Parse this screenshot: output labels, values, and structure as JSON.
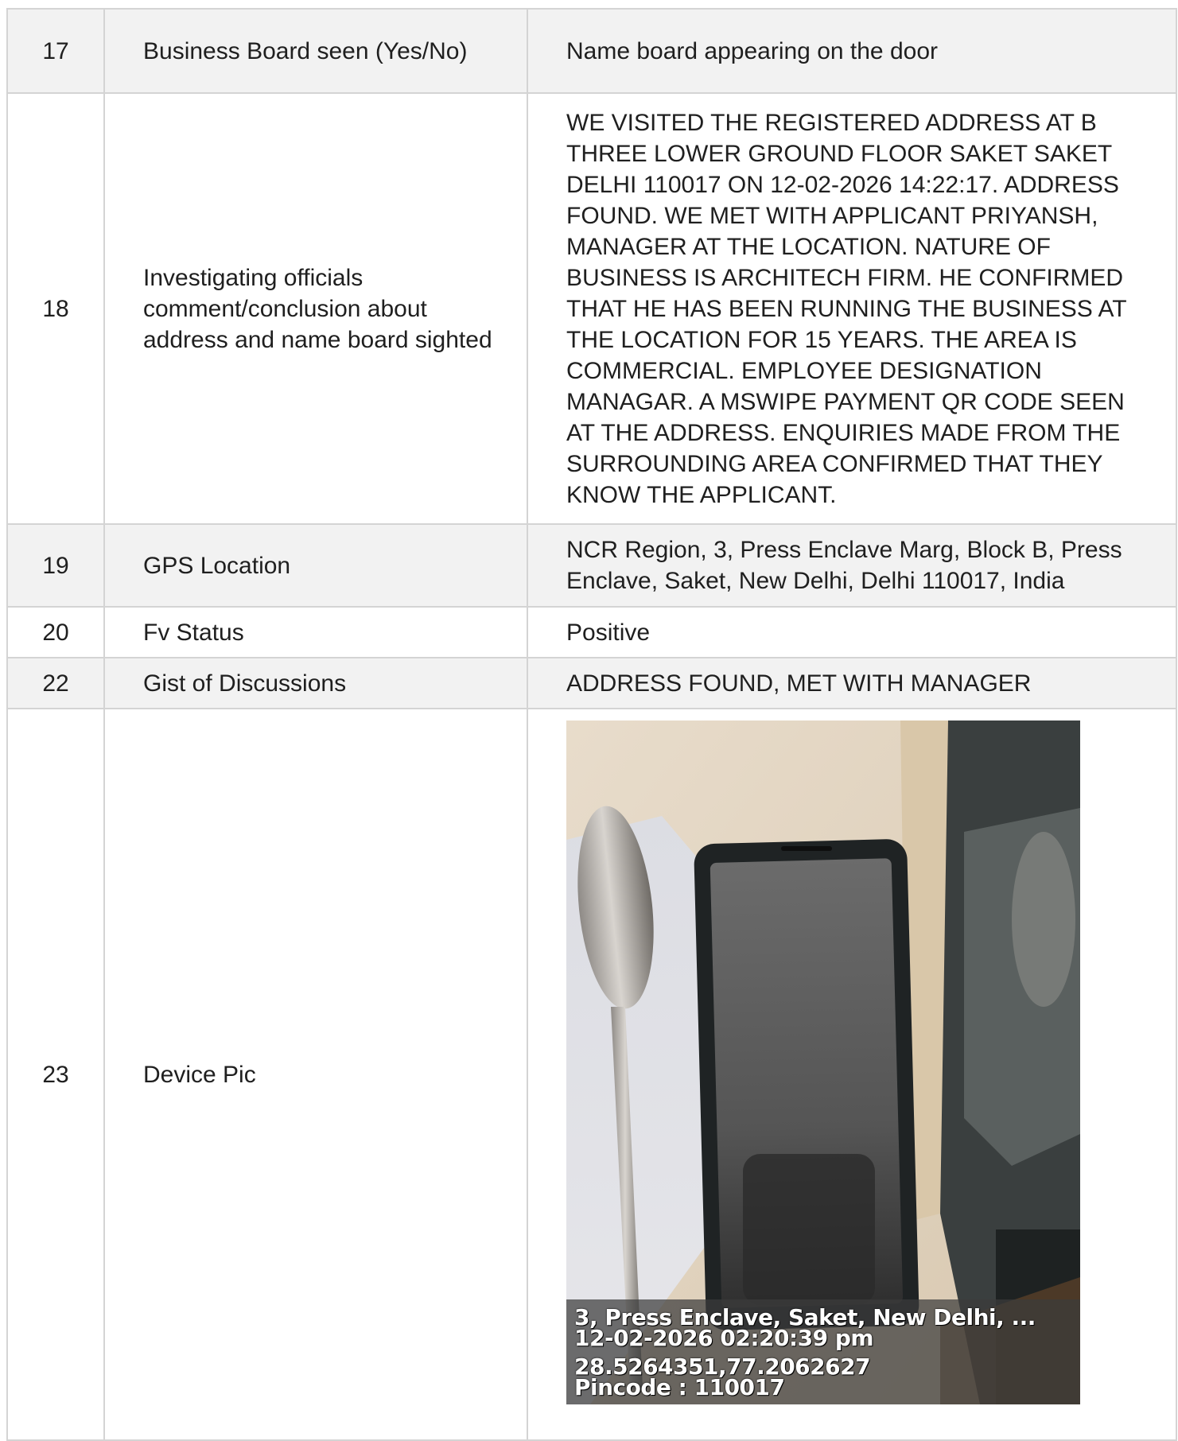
{
  "rows": [
    {
      "num": "17",
      "label": "Business Board seen (Yes/No)",
      "value": "Name board appearing on the door"
    },
    {
      "num": "18",
      "label": "Investigating officials comment/conclusion about address and name board sighted",
      "value": "WE VISITED THE REGISTERED ADDRESS AT B THREE LOWER GROUND FLOOR SAKET SAKET DELHI 110017 ON 12-02-2026 14:22:17. ADDRESS FOUND. WE MET WITH APPLICANT PRIYANSH, MANAGER AT THE LOCATION. NATURE OF BUSINESS IS ARCHITECH FIRM. HE CONFIRMED THAT HE HAS BEEN RUNNING THE BUSINESS AT THE LOCATION FOR 15 YEARS. THE AREA IS COMMERCIAL. EMPLOYEE DESIGNATION MANAGAR. A MSWIPE PAYMENT QR CODE SEEN AT THE ADDRESS. ENQUIRIES MADE FROM THE SURROUNDING AREA CONFIRMED THAT THEY KNOW THE APPLICANT."
    },
    {
      "num": "19",
      "label": "GPS Location",
      "value": "NCR Region, 3, Press Enclave Marg, Block B, Press Enclave, Saket, New Delhi, Delhi 110017, India"
    },
    {
      "num": "20",
      "label": "Fv Status",
      "value": "Positive"
    },
    {
      "num": "22",
      "label": "Gist of Discussions",
      "value": "ADDRESS FOUND, MET WITH MANAGER"
    },
    {
      "num": "23",
      "label": "Device Pic"
    }
  ],
  "photo": {
    "stamp": {
      "address": "3, Press Enclave, Saket, New Delhi, ...",
      "datetime": "12-02-2026 02:20:39 pm",
      "coordinates": "28.5264351,77.2062627",
      "pincode": "Pincode : 110017"
    }
  }
}
